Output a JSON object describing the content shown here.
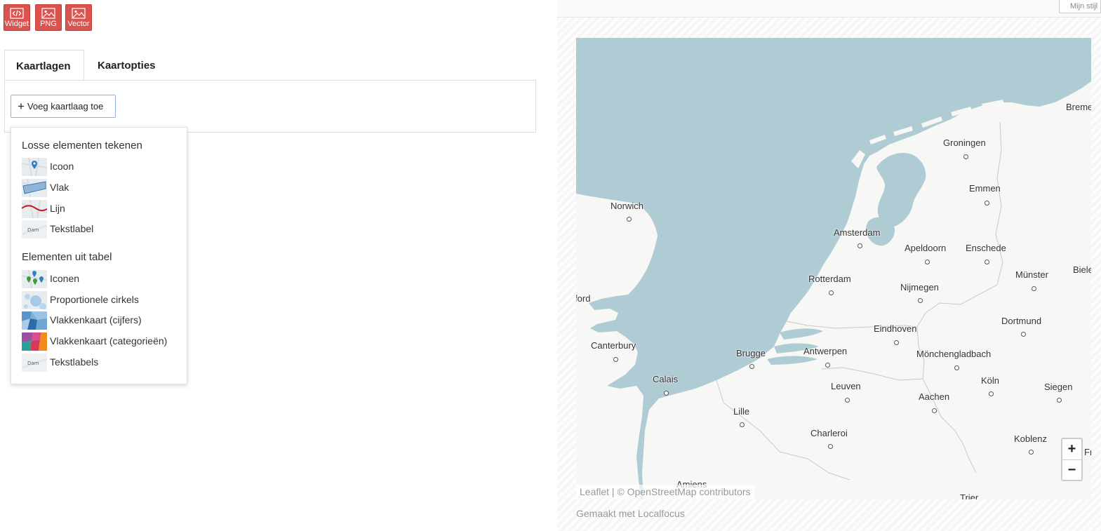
{
  "export": {
    "widget": "Widget",
    "png": "PNG",
    "vector": "Vector"
  },
  "tabs": {
    "layers": "Kaartlagen",
    "options": "Kaartopties"
  },
  "add_layer_button": "Voeg kaartlaag toe",
  "menu": {
    "section_draw": "Losse elementen tekenen",
    "draw_items": [
      "Icoon",
      "Vlak",
      "Lijn",
      "Tekstlabel"
    ],
    "section_table": "Elementen uit tabel",
    "table_items": [
      "Iconen",
      "Proportionele cirkels",
      "Vlakkenkaart (cijfers)",
      "Vlakkenkaart (categorieën)",
      "Tekstlabels"
    ]
  },
  "style_input_placeholder": "Mijn stijl",
  "map": {
    "cities": [
      "Bremen",
      "Groningen",
      "Emmen",
      "Norwich",
      "Amsterdam",
      "Apeldoorn",
      "Enschede",
      "Münster",
      "Biele",
      "Rotterdam",
      "Nijmegen",
      "Chelmsford",
      "Eindhoven",
      "Dortmund",
      "Canterbury",
      "Brugge",
      "Antwerpen",
      "Mönchengladbach",
      "Calais",
      "Leuven",
      "Köln",
      "Siegen",
      "Aachen",
      "Lille",
      "Charleroi",
      "Koblenz",
      "Frankfurt am Main",
      "Amiens",
      "Trier"
    ],
    "zoom_in": "+",
    "zoom_out": "−",
    "attribution_leaflet": "Leaflet",
    "attribution_sep": " | ",
    "attribution_osm": "© OpenStreetMap contributors"
  },
  "footer": "Gemaakt met Localfocus",
  "colors": {
    "export_button": "#d9534f",
    "water": "#afcbd3",
    "land": "#f7f7f5"
  }
}
